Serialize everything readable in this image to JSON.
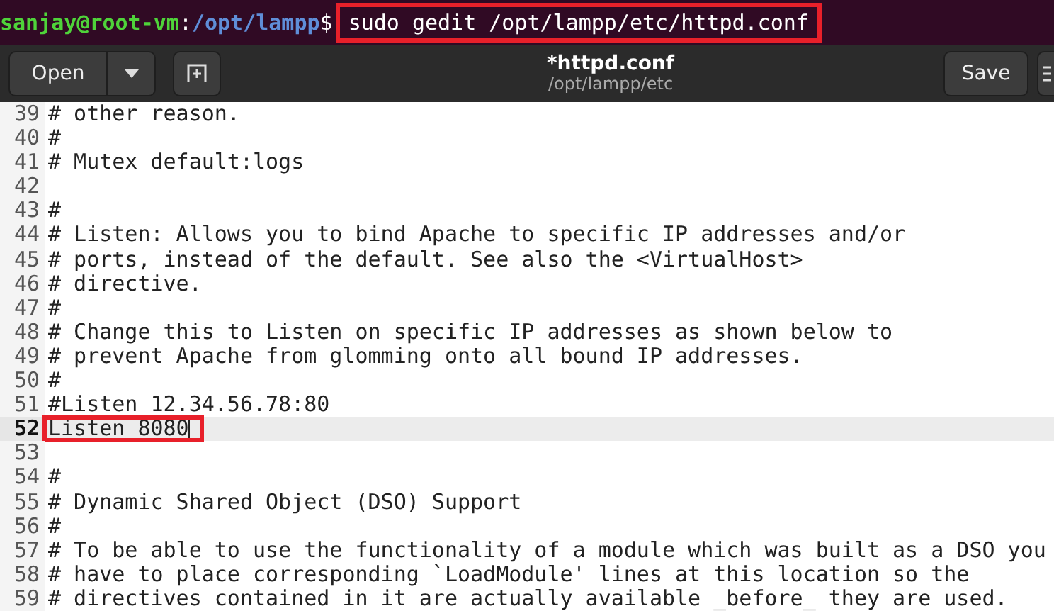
{
  "terminal": {
    "user_host": "sanjay@root-vm",
    "separator": ":",
    "path": "/opt/lampp",
    "prompt": "$",
    "command": "sudo gedit /opt/lampp/etc/httpd.conf",
    "highlighted": true
  },
  "header": {
    "open_button": "Open",
    "title": "*httpd.conf",
    "subtitle": "/opt/lampp/etc",
    "save_button": "Save"
  },
  "lines": [
    {
      "number": "39",
      "text": "# other reason.",
      "current": false,
      "highlighted": false
    },
    {
      "number": "40",
      "text": "#",
      "current": false,
      "highlighted": false
    },
    {
      "number": "41",
      "text": "# Mutex default:logs",
      "current": false,
      "highlighted": false
    },
    {
      "number": "42",
      "current": false,
      "highlighted": false
    },
    {
      "number": "43",
      "text": "#",
      "current": false,
      "highlighted": false
    },
    {
      "number": "44",
      "text": "# Listen: Allows you to bind Apache to specific IP addresses and/or",
      "current": false,
      "highlighted": false
    },
    {
      "number": "45",
      "text": "# ports, instead of the default. See also the <VirtualHost>",
      "current": false,
      "highlighted": false
    },
    {
      "number": "46",
      "text": "# directive.",
      "current": false,
      "highlighted": false
    },
    {
      "number": "47",
      "text": "#",
      "current": false,
      "highlighted": false
    },
    {
      "number": "48",
      "text": "# Change this to Listen on specific IP addresses as shown below to",
      "current": false,
      "highlighted": false
    },
    {
      "number": "49",
      "text": "# prevent Apache from glomming onto all bound IP addresses.",
      "current": false,
      "highlighted": false
    },
    {
      "number": "50",
      "text": "#",
      "current": false,
      "highlighted": false
    },
    {
      "number": "51",
      "text": "#Listen 12.34.56.78:80",
      "current": false,
      "highlighted": false
    },
    {
      "number": "52",
      "text": "Listen 8080",
      "current": true,
      "highlighted": true
    },
    {
      "number": "53",
      "current": false,
      "highlighted": false
    },
    {
      "number": "54",
      "text": "#",
      "current": false,
      "highlighted": false
    },
    {
      "number": "55",
      "text": "# Dynamic Shared Object (DSO) Support",
      "current": false,
      "highlighted": false
    },
    {
      "number": "56",
      "text": "#",
      "current": false,
      "highlighted": false
    },
    {
      "number": "57",
      "text": "# To be able to use the functionality of a module which was built as a DSO you",
      "current": false,
      "highlighted": false
    },
    {
      "number": "58",
      "text": "# have to place corresponding `LoadModule' lines at this location so the",
      "current": false,
      "highlighted": false
    },
    {
      "number": "59",
      "text": "# directives contained in it are actually available _before_ they are used.",
      "current": false,
      "highlighted": false
    }
  ]
}
